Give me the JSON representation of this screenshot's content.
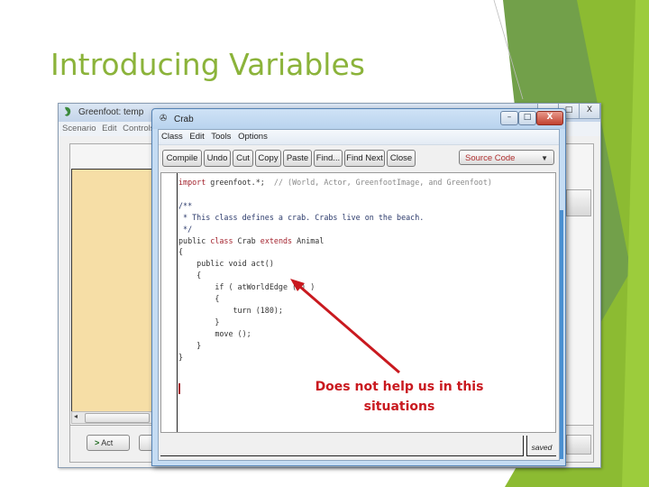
{
  "slide": {
    "title": "Introducing Variables",
    "accent_color": "#8bb33a"
  },
  "background_window": {
    "title": "Greenfoot: temp",
    "logo_icon": "greenfoot-logo-icon",
    "window_controls": [
      "_",
      "□",
      "X"
    ],
    "menu": [
      "Scenario",
      "Edit",
      "Controls"
    ],
    "act_button": {
      "icon": "play-arrow-icon",
      "label": "Act"
    }
  },
  "editor_window": {
    "title": "Crab",
    "window_controls": {
      "minimize": "–",
      "maximize": "□",
      "close": "X"
    },
    "menu": [
      "Class",
      "Edit",
      "Tools",
      "Options"
    ],
    "toolbar": [
      {
        "label": "Compile"
      },
      {
        "label": "Undo"
      },
      {
        "label": "Cut"
      },
      {
        "label": "Copy"
      },
      {
        "label": "Paste"
      },
      {
        "label": "Find..."
      },
      {
        "label": "Find Next"
      },
      {
        "label": "Close"
      }
    ],
    "view_select": {
      "value": "Source Code"
    },
    "code_lines": [
      "import greenfoot.*;  // (World, Actor, GreenfootImage, and Greenfoot)",
      "",
      "/**",
      " * This class defines a crab. Crabs live on the beach.",
      " */",
      "public class Crab extends Animal",
      "{",
      "    public void act()",
      "    {",
      "        if ( atWorldEdge ( ) )",
      "        {",
      "            turn (180);",
      "        }",
      "        move ();",
      "    }",
      "}"
    ],
    "status": "saved"
  },
  "annotation": {
    "text_line1": "Does not help us in this",
    "text_line2": "situations",
    "color": "#c9191f"
  }
}
